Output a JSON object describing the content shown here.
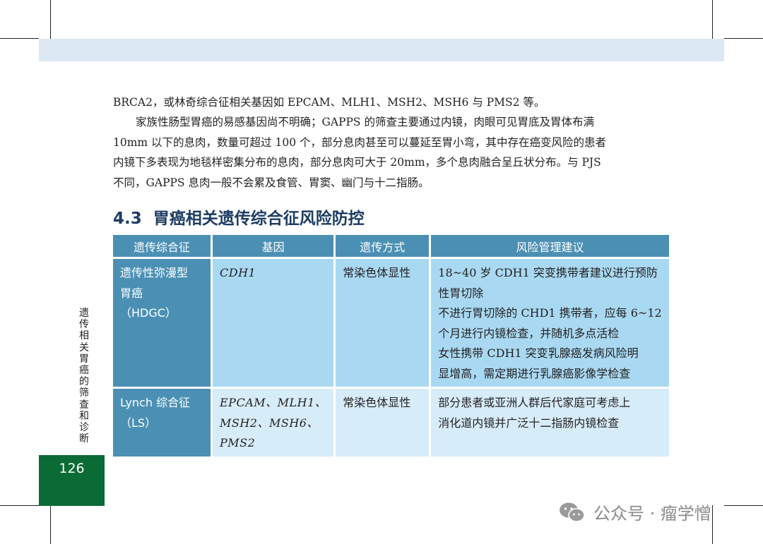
{
  "body_text": {
    "line1": "BRCA2，或林奇综合征相关基因如 EPCAM、MLH1、MSH2、MSH6 与 PMS2 等。",
    "paragraph_lines": [
      "家族性肠型胃癌的易感基因尚不明确；GAPPS 的筛查主要通过内镜，肉眼可见胃底及胃体布满",
      "10mm 以下的息肉，数量可超过 100 个，部分息肉甚至可以蔓延至胃小弯，其中存在癌变风险的患者",
      "内镜下多表现为地毯样密集分布的息肉，部分息肉可大于 20mm，多个息肉融合呈丘状分布。与 PJS",
      "不同，GAPPS 息肉一般不会累及食管、胃窦、幽门与十二指肠。"
    ]
  },
  "section": {
    "number": "4.3",
    "title": "胃癌相关遗传综合征风险防控"
  },
  "table": {
    "headers": [
      "遗传综合征",
      "基因",
      "遗传方式",
      "风险管理建议"
    ],
    "rows": [
      {
        "syndrome_lines": [
          "遗传性弥漫型",
          "胃癌",
          "（HDGC）"
        ],
        "gene_lines": [
          "CDH1"
        ],
        "inheritance": "常染色体显性",
        "advice_lines": [
          "18~40 岁 CDH1 突变携带者建议进行预防",
          "性胃切除",
          "不进行胃切除的 CHD1 携带者，应每 6~12",
          "个月进行内镜检查，并随机多点活检",
          "女性携带 CDH1 突变乳腺癌发病风险明",
          "显增高，需定期进行乳腺癌影像学检查"
        ]
      },
      {
        "syndrome_lines": [
          "Lynch 综合征",
          "（LS）"
        ],
        "gene_lines": [
          "EPCAM、MLH1、",
          "MSH2、MSH6、",
          "PMS2"
        ],
        "inheritance": "常染色体显性",
        "advice_lines": [
          "部分患者或亚洲人群后代家庭可考虑上",
          "消化道内镜并广泛十二指肠内镜检查"
        ]
      }
    ]
  },
  "side_label": [
    "遗",
    "传",
    "相",
    "关",
    "胃",
    "癌",
    "的",
    "筛",
    "查",
    "和",
    "诊",
    "断"
  ],
  "page_number": "126",
  "watermark": {
    "text": "公众号 · 瘤学憎",
    "icon": "wechat-icon"
  },
  "colors": {
    "header_blue": "#4b90b4",
    "row1_light": "#a9d9f2",
    "row2_light": "#d6ecf8",
    "title_navy": "#1c3d63",
    "page_green": "#0b6b34",
    "band": "#dce9f5"
  }
}
